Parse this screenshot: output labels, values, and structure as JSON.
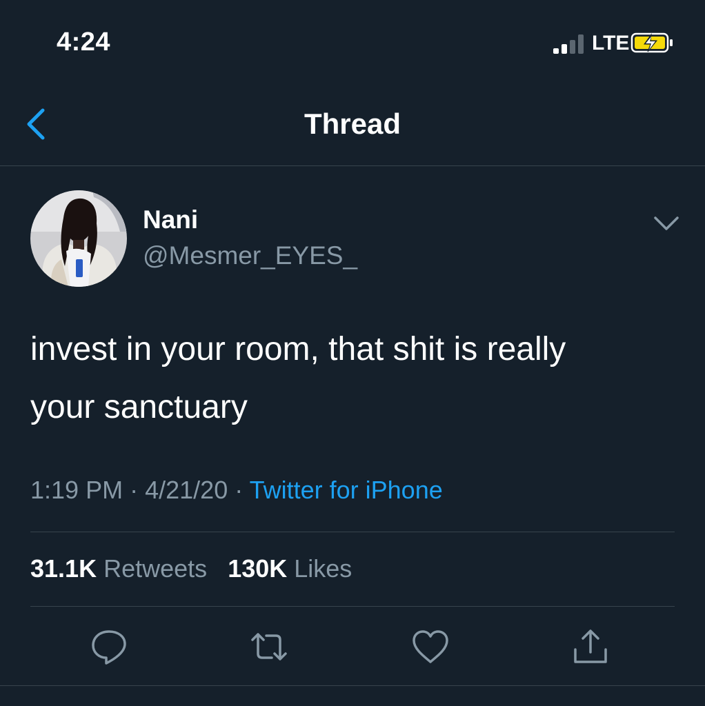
{
  "status_bar": {
    "time": "4:24",
    "network": "LTE",
    "signal_bars_filled": 2,
    "signal_bars_total": 4,
    "battery_state": "charging",
    "icons": [
      "signal-icon",
      "battery-charging-icon"
    ]
  },
  "nav": {
    "title": "Thread",
    "back_icon": "chevron-left-icon"
  },
  "tweet": {
    "display_name": "Nani",
    "handle": "@Mesmer_EYES_",
    "text_line1": "invest in your room, that shit is really",
    "text_line2": "your sanctuary",
    "time": "1:19 PM",
    "separator": "·",
    "date": "4/21/20",
    "source": "Twitter for iPhone",
    "retweets_count": "31.1K",
    "retweets_label": "Retweets",
    "likes_count": "130K",
    "likes_label": "Likes",
    "menu_icon": "chevron-down-icon"
  },
  "actions": [
    "reply-icon",
    "retweet-icon",
    "like-icon",
    "share-icon"
  ],
  "colors": {
    "background": "#15202b",
    "text": "#ffffff",
    "secondary_text": "#8899a6",
    "accent": "#1da1f2",
    "divider": "#38444d",
    "battery_charge": "#f5d90a"
  }
}
